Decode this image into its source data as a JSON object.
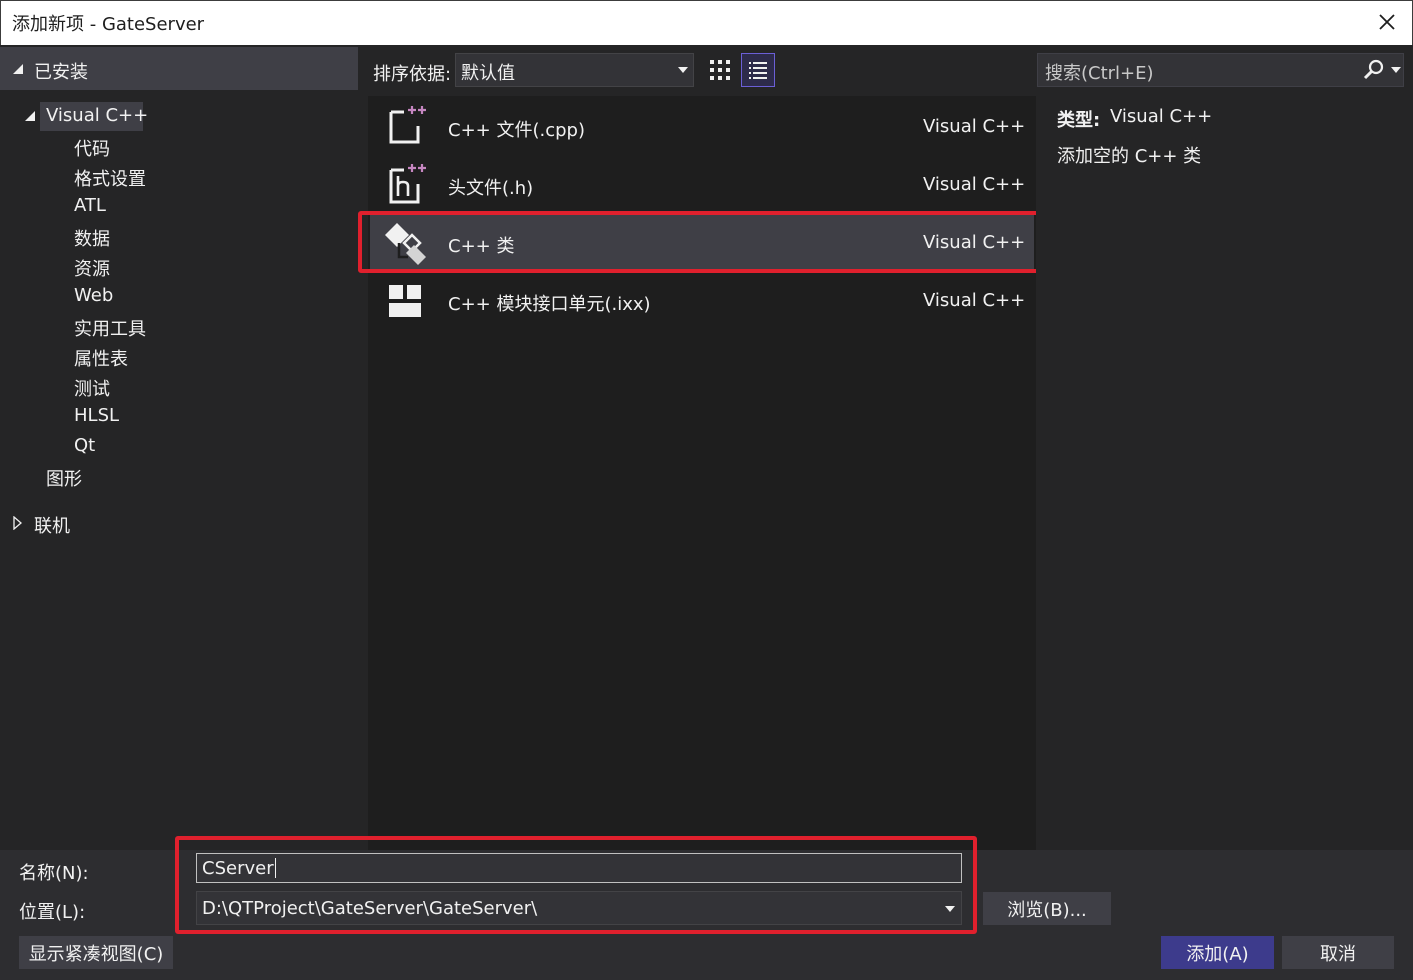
{
  "window": {
    "title": "添加新项 - GateServer"
  },
  "sidebar": {
    "installed_label": "已安装",
    "tree": {
      "root_label": "Visual C++",
      "children": [
        "代码",
        "格式设置",
        "ATL",
        "数据",
        "资源",
        "Web",
        "实用工具",
        "属性表",
        "测试",
        "HLSL",
        "Qt"
      ],
      "sibling_label": "图形"
    },
    "online_label": "联机"
  },
  "toolbar": {
    "sort_label": "排序依据:",
    "sort_value": "默认值",
    "search_placeholder": "搜索(Ctrl+E)"
  },
  "templates": [
    {
      "name": "C++ 文件(.cpp)",
      "lang": "Visual C++",
      "icon": "cpp-file-icon"
    },
    {
      "name": "头文件(.h)",
      "lang": "Visual C++",
      "icon": "header-file-icon"
    },
    {
      "name": "C++ 类",
      "lang": "Visual C++",
      "icon": "cpp-class-icon",
      "selected": true
    },
    {
      "name": "C++ 模块接口单元(.ixx)",
      "lang": "Visual C++",
      "icon": "module-interface-icon"
    }
  ],
  "details": {
    "type_label": "类型:",
    "type_value": "Visual C++",
    "description": "添加空的 C++ 类"
  },
  "form": {
    "name_label": "名称(N):",
    "name_value": "CServer",
    "location_label": "位置(L):",
    "location_value": "D:\\QTProject\\GateServer\\GateServer\\",
    "browse_label": "浏览(B)...",
    "compact_view_label": "显示紧凑视图(C)",
    "add_label": "添加(A)",
    "cancel_label": "取消"
  },
  "colors": {
    "accent": "#3d3b8c",
    "highlight": "#e0202d",
    "selected_row": "#3f3f46",
    "icon_magenta": "#c586c0"
  }
}
